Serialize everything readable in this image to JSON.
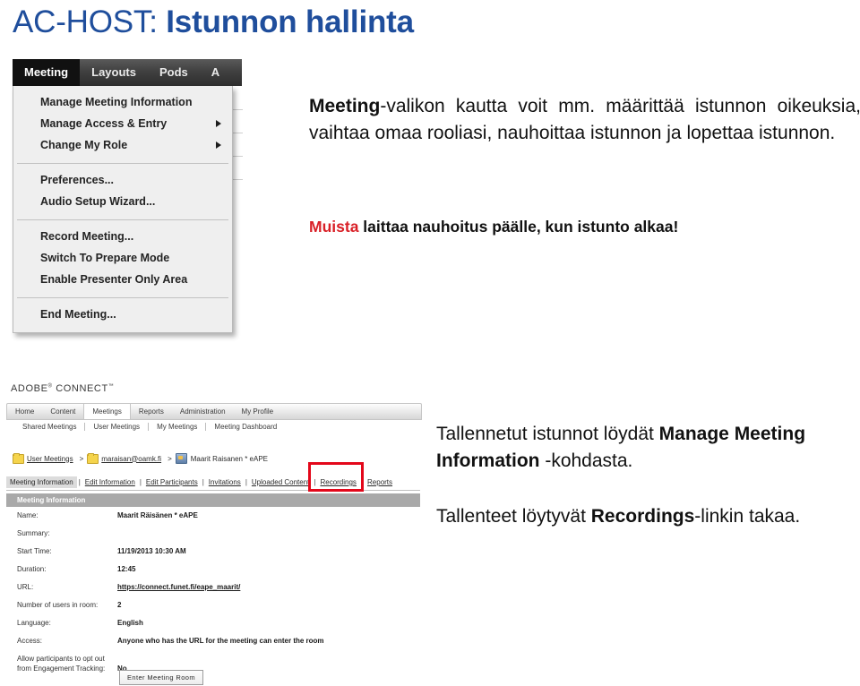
{
  "slide": {
    "title_light": "AC-HOST: ",
    "title_bold": "Istunnon hallinta"
  },
  "meeting_menu": {
    "menubar": [
      {
        "label": "Meeting",
        "active": true
      },
      {
        "label": "Layouts",
        "active": false
      },
      {
        "label": "Pods",
        "active": false
      },
      {
        "label": "A",
        "active": false
      }
    ],
    "groups": [
      [
        {
          "label": "Manage Meeting Information",
          "submenu": false
        },
        {
          "label": "Manage Access & Entry",
          "submenu": true
        },
        {
          "label": "Change My Role",
          "submenu": true
        }
      ],
      [
        {
          "label": "Preferences...",
          "submenu": false
        },
        {
          "label": "Audio Setup Wizard...",
          "submenu": false
        }
      ],
      [
        {
          "label": "Record Meeting...",
          "submenu": false
        },
        {
          "label": "Switch To Prepare Mode",
          "submenu": false
        },
        {
          "label": "Enable Presenter Only Area",
          "submenu": false
        }
      ],
      [
        {
          "label": "End Meeting...",
          "submenu": false
        }
      ]
    ]
  },
  "text_top": {
    "bold_lead": "Meeting",
    "body": "-valikon kautta voit mm. määrittää istunnon oikeuksia, vaihtaa omaa rooliasi, nauhoittaa istunnon ja lopettaa istunnon."
  },
  "text_note": {
    "highlight": "Muista",
    "rest": " laittaa nauhoitus päälle, kun istunto alkaa!",
    "highlight_color": "#D92027"
  },
  "adobe_connect": {
    "logo": "ADOBE",
    "logo_reg": "®",
    "logo_product": " CONNECT",
    "logo_tm": "™",
    "tabs": [
      {
        "label": "Home",
        "active": false
      },
      {
        "label": "Content",
        "active": false
      },
      {
        "label": "Meetings",
        "active": true
      },
      {
        "label": "Reports",
        "active": false
      },
      {
        "label": "Administration",
        "active": false
      },
      {
        "label": "My Profile",
        "active": false
      }
    ],
    "subnav": [
      "Shared Meetings",
      "User Meetings",
      "My Meetings",
      "Meeting Dashboard"
    ],
    "breadcrumb": {
      "item1": "User Meetings",
      "sep1": ">",
      "item2": "maraisan@oamk.fi",
      "sep2": ">",
      "item3": "Maarit Raisanen * eAPE"
    },
    "actionbar": {
      "current": "Meeting Information",
      "links": [
        "Edit Information",
        "Edit Participants",
        "Invitations",
        "Uploaded Content",
        "Recordings",
        "Reports"
      ]
    },
    "panel_header": "Meeting Information",
    "info_rows": [
      {
        "label": "Name:",
        "value": "Maarit Räisänen * eAPE",
        "link": false
      },
      {
        "label": "Summary:",
        "value": "",
        "link": false
      },
      {
        "label": "Start Time:",
        "value": "11/19/2013 10:30 AM",
        "link": false
      },
      {
        "label": "Duration:",
        "value": "12:45",
        "link": false
      },
      {
        "label": "URL:",
        "value": "https://connect.funet.fi/eape_maarit/",
        "link": true
      },
      {
        "label": "Number of users in room:",
        "value": "2",
        "link": false
      },
      {
        "label": "Language:",
        "value": "English",
        "link": false
      },
      {
        "label": "Access:",
        "value": "Anyone who has the URL for the meeting can enter the room",
        "link": false
      },
      {
        "label": "Allow participants to opt out from Engagement Tracking:",
        "value": "No",
        "link": false
      }
    ],
    "enter_button": "Enter Meeting Room",
    "highlight_color": "#E3071A"
  },
  "text_bottom_1": {
    "line1": "Tallennetut istunnot löydät ",
    "bold": "Manage Meeting Information",
    "line2": " -kohdasta."
  },
  "text_bottom_2": {
    "line1": "Tallenteet löytyvät ",
    "bold": "Recordings",
    "line2": "-linkin takaa."
  }
}
